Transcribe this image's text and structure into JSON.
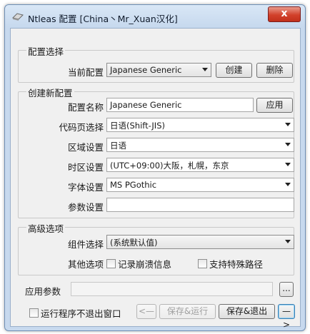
{
  "window": {
    "title": "Ntleas 配置 [China丶Mr_Xuan汉化]",
    "close_label": "x"
  },
  "config_select": {
    "group_title": "配置选择",
    "current_label": "当前配置",
    "current_value": "Japanese Generic",
    "create_label": "创建",
    "delete_label": "删除"
  },
  "new_config": {
    "group_title": "创建新配置",
    "name_label": "配置名称",
    "name_value": "Japanese Generic",
    "apply_label": "应用",
    "codepage_label": "代码页选择",
    "codepage_value": "日语(Shift-JIS)",
    "region_label": "区域设置",
    "region_value": "日语",
    "timezone_label": "时区设置",
    "timezone_value": "(UTC+09:00)大阪，札幌，东京",
    "font_label": "字体设置",
    "font_value": "MS PGothic",
    "params_label": "参数设置",
    "params_value": ""
  },
  "advanced": {
    "group_title": "高级选项",
    "component_label": "组件选择",
    "component_value": "(系统默认值)",
    "other_label": "其他选项",
    "crash_log_label": "记录崩溃信息",
    "special_path_label": "支持特殊路径"
  },
  "footer": {
    "app_params_label": "应用参数",
    "app_params_value": "",
    "browse_label": "...",
    "keep_running_label": "运行程序不退出窗口",
    "prev_label": "<—",
    "save_run_label": "保存&运行",
    "save_exit_label": "保存&退出",
    "next_label": "—>"
  }
}
